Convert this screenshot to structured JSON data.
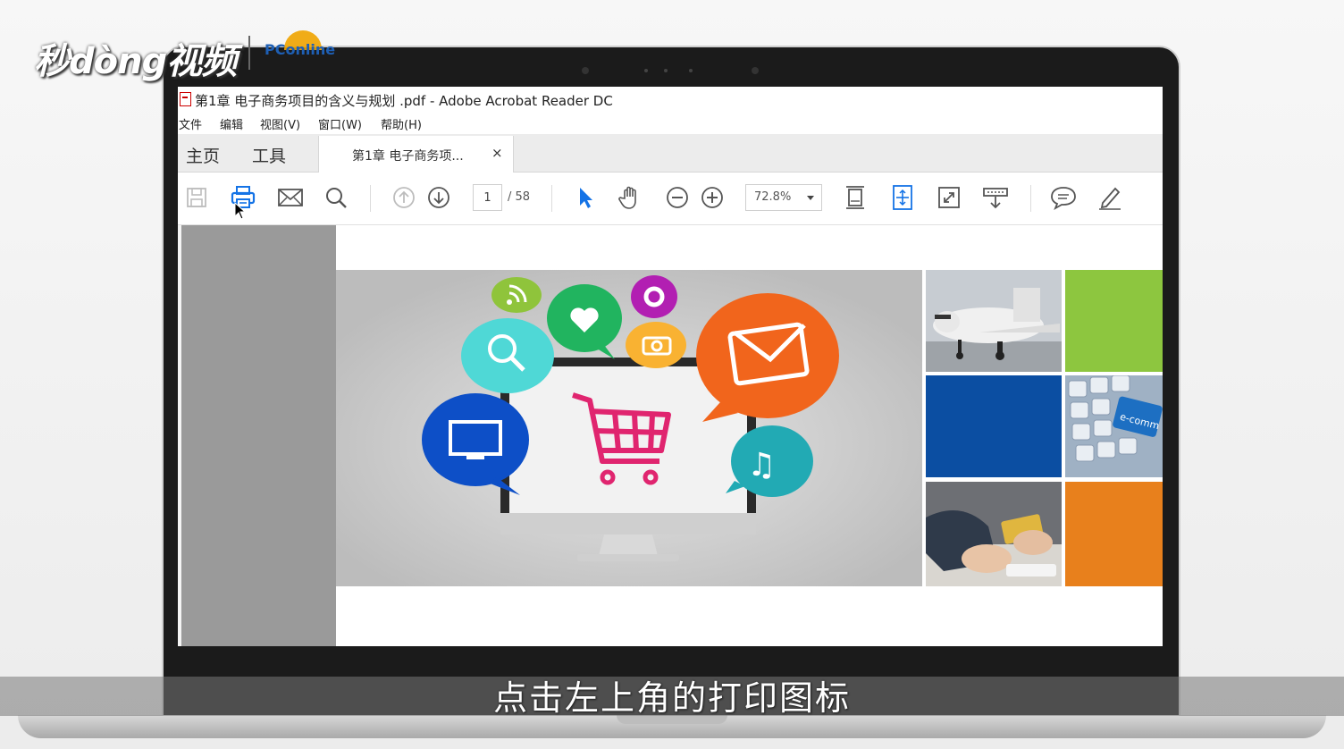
{
  "watermark": {
    "brand": "秒dòng视频",
    "partner": "PConline"
  },
  "window": {
    "title": "第1章 电子商务项目的含义与规划 .pdf - Adobe Acrobat Reader DC"
  },
  "menu": [
    {
      "label": "文件"
    },
    {
      "label": "编辑"
    },
    {
      "label": "视图(V)"
    },
    {
      "label": "窗口(W)"
    },
    {
      "label": "帮助(H)"
    }
  ],
  "tabs": {
    "home": "主页",
    "tools": "工具",
    "document": "第1章 电子商务项...",
    "close": "×"
  },
  "toolbar": {
    "current_page": "1",
    "total_pages": "/ 58",
    "zoom": "72.8%",
    "icons": [
      "save-icon",
      "print-icon",
      "email-icon",
      "search-icon",
      "page-up-icon",
      "page-down-icon",
      "select-cursor-icon",
      "hand-tool-icon",
      "zoom-out-icon",
      "zoom-in-icon",
      "fit-page-icon",
      "rotate-icon",
      "fullscreen-icon",
      "read-mode-icon",
      "comment-icon",
      "sign-icon"
    ]
  },
  "subtitle": "点击左上角的打印图标",
  "colors": {
    "accent": "#1473e6",
    "green": "#8dc63f",
    "blue": "#0b4ea2",
    "orange": "#e8801c"
  }
}
